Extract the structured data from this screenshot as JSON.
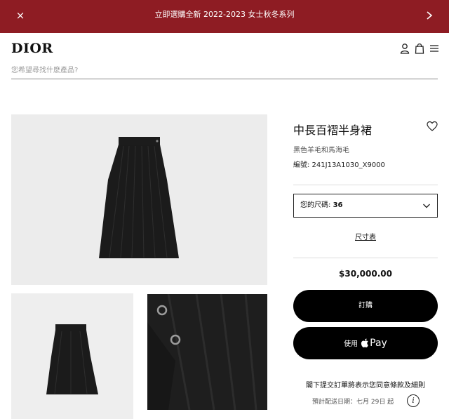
{
  "banner": {
    "close_symbol": "×",
    "message": "立即選購全新 2022-2023 女士秋冬系列",
    "background_color": "#8e1c23",
    "next_icon": "chevron-right-icon"
  },
  "header": {
    "logo": "DIOR",
    "icons": [
      "user-icon",
      "shopping-bag-icon",
      "menu-icon"
    ],
    "search": {
      "placeholder": "您希望尋找什麽產品?",
      "value": ""
    }
  },
  "product": {
    "title": "中長百褶半身裙",
    "material": "黑色羊毛和馬海毛",
    "reference": "編號: 241J13A1030_X9000",
    "size": {
      "label": "您的尺碼:",
      "value": "36"
    },
    "size_guide": "尺寸表",
    "price": "$30,000.00",
    "order_button": "訂購",
    "applepay_button": {
      "prefix": "使用",
      "pay": "Pay"
    },
    "terms": "閣下提交訂單將表示您同意條款及細則",
    "delivery": "預計配送日期：七月 29日 起",
    "info_symbol": "i"
  },
  "images": [
    "skirt-front-image",
    "skirt-side-image",
    "fabric-detail-image"
  ]
}
